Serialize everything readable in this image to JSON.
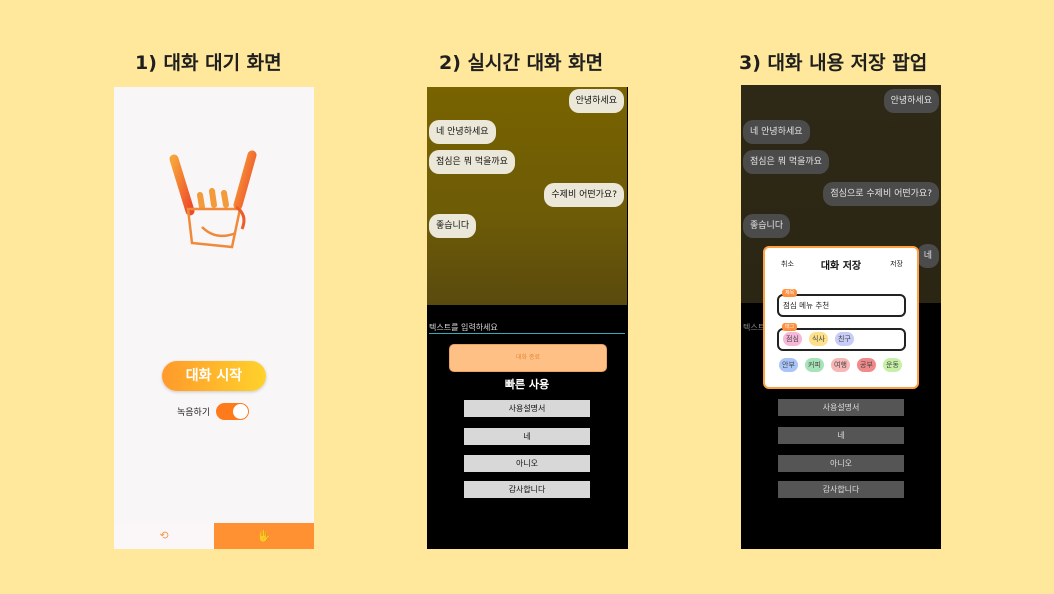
{
  "headings": {
    "screen1": "1) 대화 대기 화면",
    "screen2": "2) 실시간 대화 화면",
    "screen3": "3) 대화 내용 저장 팝업"
  },
  "screen1": {
    "start_button": "대화 시작",
    "record_label": "녹음하기",
    "record_toggle_on": true,
    "tab_history_icon": "history-icon",
    "tab_gesture_icon": "hand-icon",
    "accent": "#ff9133"
  },
  "screen2": {
    "messages": [
      {
        "text": "안녕하세요",
        "side": "right"
      },
      {
        "text": "네 안녕하세요",
        "side": "left"
      },
      {
        "text": "점심은 뭐 먹을까요",
        "side": "left"
      },
      {
        "text": "수제비 어떤가요?",
        "side": "right"
      },
      {
        "text": "좋습니다",
        "side": "left"
      }
    ],
    "input_placeholder": "텍스트를 입력하세요",
    "end_button": "대화 종료",
    "quick_title": "빠른 사용",
    "quick_buttons": [
      "사용설명서",
      "네",
      "아니오",
      "감사합니다"
    ]
  },
  "screen3": {
    "messages": [
      {
        "text": "안녕하세요",
        "side": "right"
      },
      {
        "text": "네 안녕하세요",
        "side": "left"
      },
      {
        "text": "점심은 뭐 먹을까요",
        "side": "left"
      },
      {
        "text": "점심으로 수제비 어떤가요?",
        "side": "right"
      },
      {
        "text": "좋습니다",
        "side": "left"
      },
      {
        "text": "네",
        "side": "right"
      }
    ],
    "input_placeholder": "텍스트",
    "quick_buttons": [
      "사용설명서",
      "네",
      "아니오",
      "감사합니다"
    ],
    "popup": {
      "cancel": "취소",
      "title": "대화 저장",
      "save": "저장",
      "title_badge": "제목",
      "title_value": "점심 메뉴 추천",
      "tag_badge": "태그",
      "selected_tags": [
        "점심",
        "식사",
        "친구"
      ],
      "tag_options": [
        "안부",
        "커피",
        "여행",
        "공부",
        "운동"
      ]
    }
  }
}
